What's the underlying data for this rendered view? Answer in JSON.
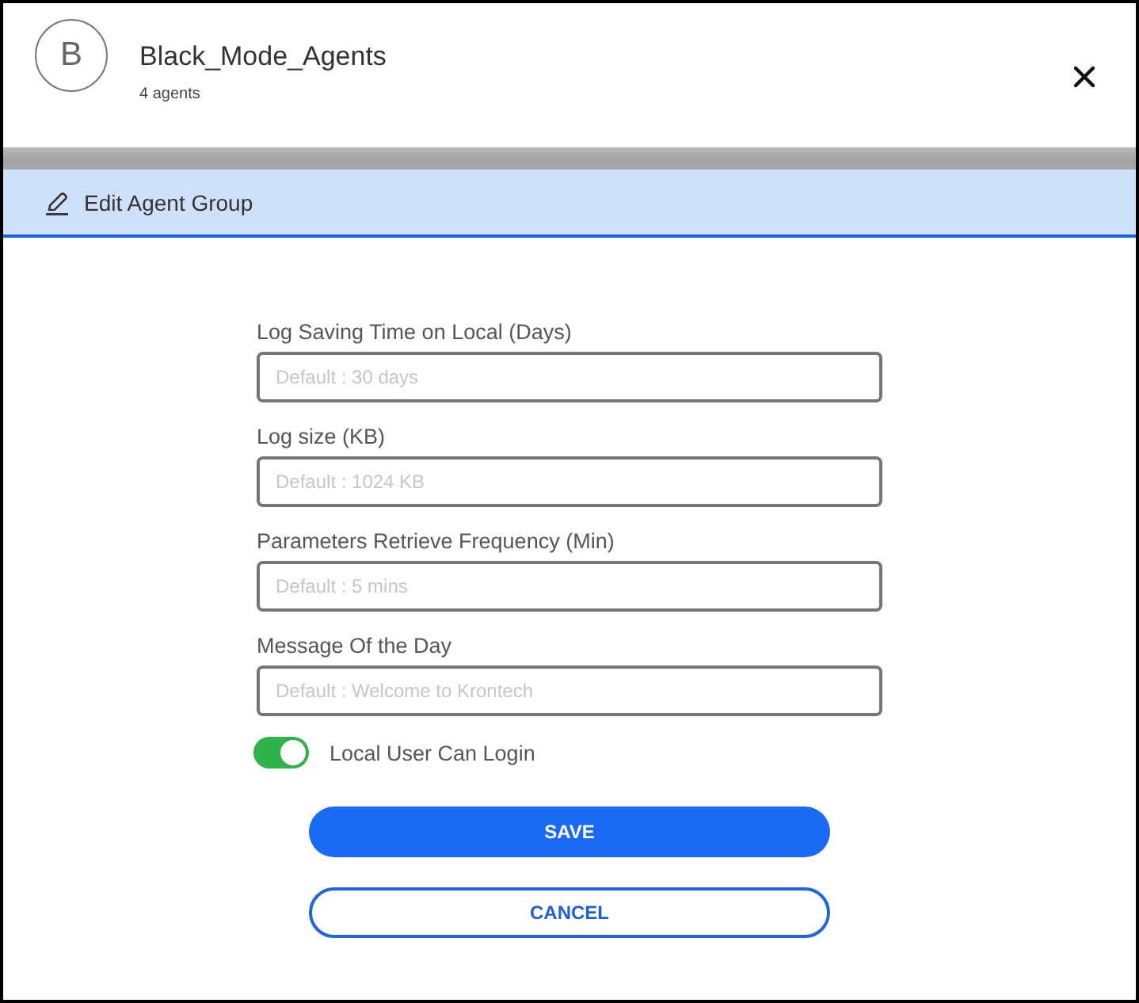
{
  "header": {
    "avatar_letter": "B",
    "title": "Black_Mode_Agents",
    "subtitle": "4 agents"
  },
  "section": {
    "title": "Edit Agent Group"
  },
  "fields": [
    {
      "label": "Log Saving Time on Local (Days)",
      "placeholder": "Default : 30 days"
    },
    {
      "label": "Log size (KB)",
      "placeholder": "Default : 1024 KB"
    },
    {
      "label": "Parameters Retrieve Frequency (Min)",
      "placeholder": "Default : 5 mins"
    },
    {
      "label": "Message Of the Day",
      "placeholder": "Default : Welcome to Krontech"
    }
  ],
  "toggle": {
    "label": "Local User Can Login",
    "on": true
  },
  "buttons": [
    {
      "label": "SAVE",
      "kind": "primary"
    },
    {
      "label": "CANCEL",
      "kind": "secondary"
    }
  ]
}
